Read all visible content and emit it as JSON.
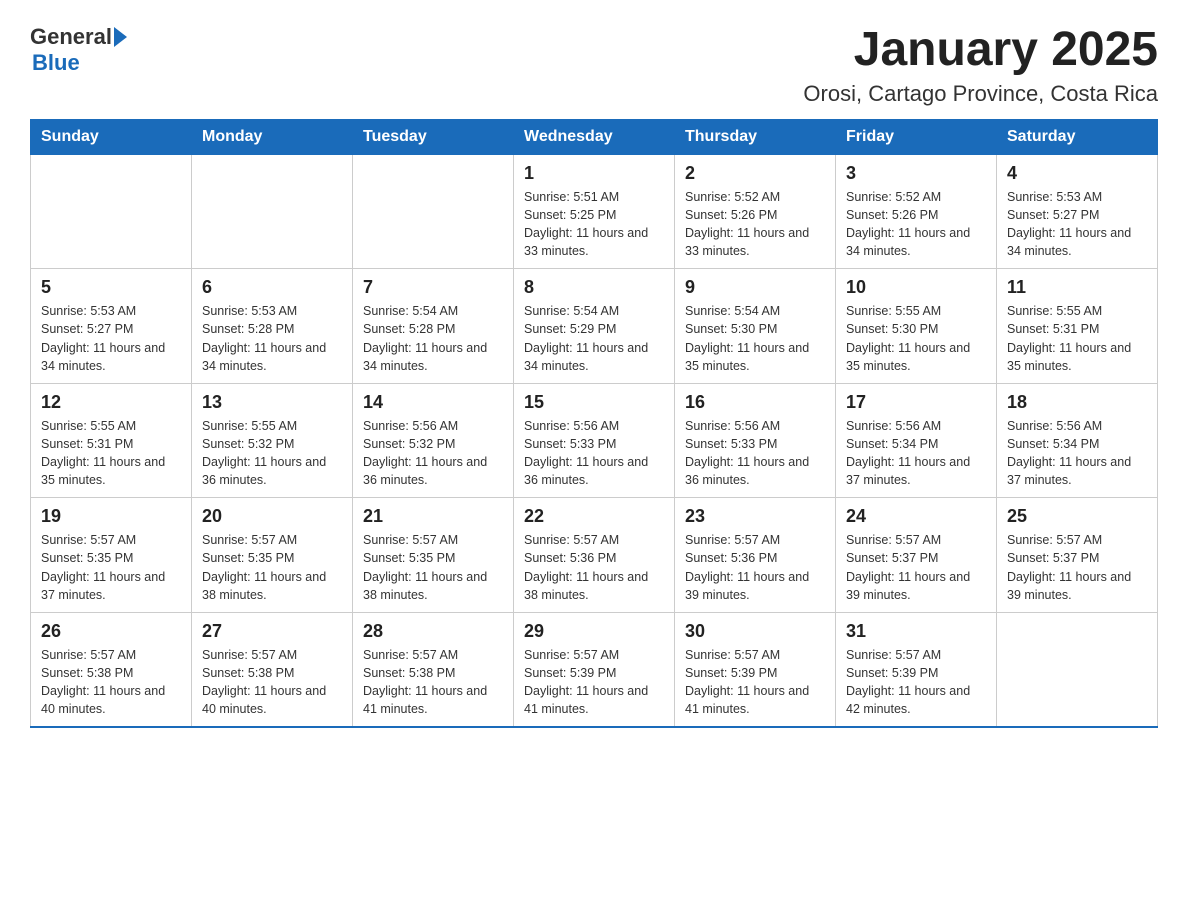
{
  "header": {
    "logo_text_general": "General",
    "logo_text_blue": "Blue",
    "main_title": "January 2025",
    "subtitle": "Orosi, Cartago Province, Costa Rica"
  },
  "calendar": {
    "days_of_week": [
      "Sunday",
      "Monday",
      "Tuesday",
      "Wednesday",
      "Thursday",
      "Friday",
      "Saturday"
    ],
    "weeks": [
      [
        {
          "day": "",
          "info": ""
        },
        {
          "day": "",
          "info": ""
        },
        {
          "day": "",
          "info": ""
        },
        {
          "day": "1",
          "info": "Sunrise: 5:51 AM\nSunset: 5:25 PM\nDaylight: 11 hours and 33 minutes."
        },
        {
          "day": "2",
          "info": "Sunrise: 5:52 AM\nSunset: 5:26 PM\nDaylight: 11 hours and 33 minutes."
        },
        {
          "day": "3",
          "info": "Sunrise: 5:52 AM\nSunset: 5:26 PM\nDaylight: 11 hours and 34 minutes."
        },
        {
          "day": "4",
          "info": "Sunrise: 5:53 AM\nSunset: 5:27 PM\nDaylight: 11 hours and 34 minutes."
        }
      ],
      [
        {
          "day": "5",
          "info": "Sunrise: 5:53 AM\nSunset: 5:27 PM\nDaylight: 11 hours and 34 minutes."
        },
        {
          "day": "6",
          "info": "Sunrise: 5:53 AM\nSunset: 5:28 PM\nDaylight: 11 hours and 34 minutes."
        },
        {
          "day": "7",
          "info": "Sunrise: 5:54 AM\nSunset: 5:28 PM\nDaylight: 11 hours and 34 minutes."
        },
        {
          "day": "8",
          "info": "Sunrise: 5:54 AM\nSunset: 5:29 PM\nDaylight: 11 hours and 34 minutes."
        },
        {
          "day": "9",
          "info": "Sunrise: 5:54 AM\nSunset: 5:30 PM\nDaylight: 11 hours and 35 minutes."
        },
        {
          "day": "10",
          "info": "Sunrise: 5:55 AM\nSunset: 5:30 PM\nDaylight: 11 hours and 35 minutes."
        },
        {
          "day": "11",
          "info": "Sunrise: 5:55 AM\nSunset: 5:31 PM\nDaylight: 11 hours and 35 minutes."
        }
      ],
      [
        {
          "day": "12",
          "info": "Sunrise: 5:55 AM\nSunset: 5:31 PM\nDaylight: 11 hours and 35 minutes."
        },
        {
          "day": "13",
          "info": "Sunrise: 5:55 AM\nSunset: 5:32 PM\nDaylight: 11 hours and 36 minutes."
        },
        {
          "day": "14",
          "info": "Sunrise: 5:56 AM\nSunset: 5:32 PM\nDaylight: 11 hours and 36 minutes."
        },
        {
          "day": "15",
          "info": "Sunrise: 5:56 AM\nSunset: 5:33 PM\nDaylight: 11 hours and 36 minutes."
        },
        {
          "day": "16",
          "info": "Sunrise: 5:56 AM\nSunset: 5:33 PM\nDaylight: 11 hours and 36 minutes."
        },
        {
          "day": "17",
          "info": "Sunrise: 5:56 AM\nSunset: 5:34 PM\nDaylight: 11 hours and 37 minutes."
        },
        {
          "day": "18",
          "info": "Sunrise: 5:56 AM\nSunset: 5:34 PM\nDaylight: 11 hours and 37 minutes."
        }
      ],
      [
        {
          "day": "19",
          "info": "Sunrise: 5:57 AM\nSunset: 5:35 PM\nDaylight: 11 hours and 37 minutes."
        },
        {
          "day": "20",
          "info": "Sunrise: 5:57 AM\nSunset: 5:35 PM\nDaylight: 11 hours and 38 minutes."
        },
        {
          "day": "21",
          "info": "Sunrise: 5:57 AM\nSunset: 5:35 PM\nDaylight: 11 hours and 38 minutes."
        },
        {
          "day": "22",
          "info": "Sunrise: 5:57 AM\nSunset: 5:36 PM\nDaylight: 11 hours and 38 minutes."
        },
        {
          "day": "23",
          "info": "Sunrise: 5:57 AM\nSunset: 5:36 PM\nDaylight: 11 hours and 39 minutes."
        },
        {
          "day": "24",
          "info": "Sunrise: 5:57 AM\nSunset: 5:37 PM\nDaylight: 11 hours and 39 minutes."
        },
        {
          "day": "25",
          "info": "Sunrise: 5:57 AM\nSunset: 5:37 PM\nDaylight: 11 hours and 39 minutes."
        }
      ],
      [
        {
          "day": "26",
          "info": "Sunrise: 5:57 AM\nSunset: 5:38 PM\nDaylight: 11 hours and 40 minutes."
        },
        {
          "day": "27",
          "info": "Sunrise: 5:57 AM\nSunset: 5:38 PM\nDaylight: 11 hours and 40 minutes."
        },
        {
          "day": "28",
          "info": "Sunrise: 5:57 AM\nSunset: 5:38 PM\nDaylight: 11 hours and 41 minutes."
        },
        {
          "day": "29",
          "info": "Sunrise: 5:57 AM\nSunset: 5:39 PM\nDaylight: 11 hours and 41 minutes."
        },
        {
          "day": "30",
          "info": "Sunrise: 5:57 AM\nSunset: 5:39 PM\nDaylight: 11 hours and 41 minutes."
        },
        {
          "day": "31",
          "info": "Sunrise: 5:57 AM\nSunset: 5:39 PM\nDaylight: 11 hours and 42 minutes."
        },
        {
          "day": "",
          "info": ""
        }
      ]
    ]
  }
}
